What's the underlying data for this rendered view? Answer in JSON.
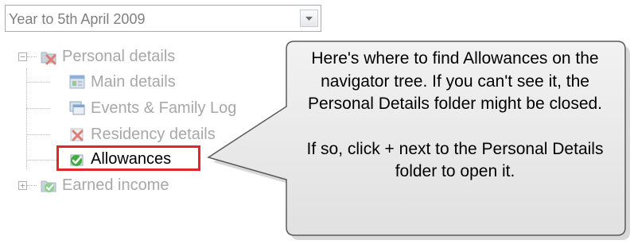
{
  "period_select": {
    "value": "Year to 5th April 2009"
  },
  "tree": {
    "personal_details": {
      "label": "Personal details",
      "expander": "−",
      "icon": "red-x-folder-icon"
    },
    "main_details": {
      "label": "Main details",
      "icon": "form-icon"
    },
    "events_family_log": {
      "label": "Events & Family Log",
      "icon": "log-window-icon"
    },
    "residency_details": {
      "label": "Residency details",
      "icon": "red-x-icon"
    },
    "allowances": {
      "label": "Allowances",
      "icon": "green-check-icon"
    },
    "earned_income": {
      "label": "Earned income",
      "expander": "+",
      "icon": "green-check-folder-icon"
    }
  },
  "callout": {
    "paragraph_1": "Here's where to find Allowances on the navigator tree. If you can't see it, the Personal Details folder might be closed.",
    "paragraph_2": "If so, click + next to the Personal Details folder to open it."
  },
  "colors": {
    "highlight_border": "#e3262c",
    "callout_fill": "#e8e8e8",
    "callout_border": "#5a5a5a",
    "disabled_text": "#a8a8a8"
  }
}
